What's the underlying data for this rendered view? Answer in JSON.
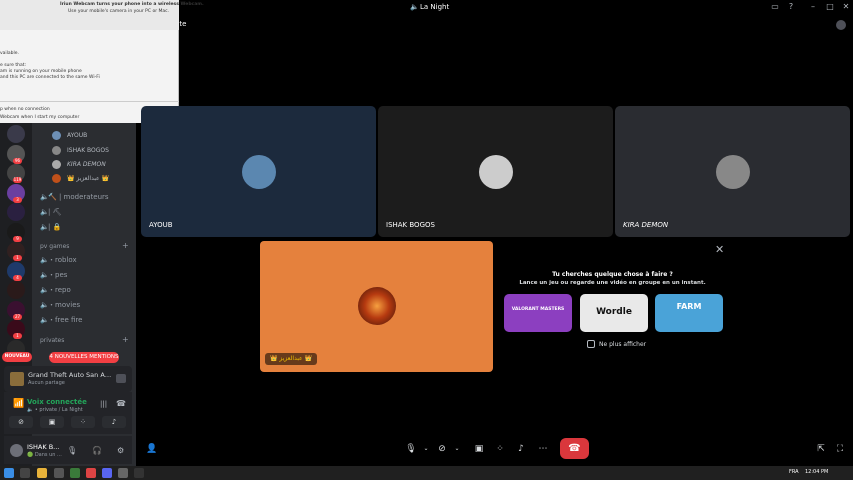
{
  "window": {
    "title": "La Night",
    "channel_header": "vate",
    "controls": {
      "minimize": "–",
      "maximize": "□",
      "close": "✕"
    }
  },
  "overlay": {
    "header_line1": "Iriun Webcam turns your phone into a wireless Webcam.",
    "header_line2": "Use your mobile's camera in your PC or Mac.",
    "line_available": "vailable.",
    "line_sure": "e sure that:",
    "line_running": "am is running on your mobile phone",
    "line_connected": "and this PC are connected to the same Wi-Fi",
    "line_noconn": "p when no connection",
    "line_start": "Webcam when I start my computer"
  },
  "servers": [
    {
      "color": "#3a3a4a",
      "badge": ""
    },
    {
      "color": "#555555",
      "badge": "96"
    },
    {
      "color": "#444444",
      "badge": "119"
    },
    {
      "color": "#6a3fa0",
      "badge": "3"
    },
    {
      "color": "#2a2040",
      "badge": ""
    },
    {
      "color": "#1a1a1a",
      "badge": "9"
    },
    {
      "color": "#302020",
      "badge": "1"
    },
    {
      "color": "#1e3a6a",
      "badge": "4"
    },
    {
      "color": "#2a1a1a",
      "badge": ""
    },
    {
      "color": "#3a1030",
      "badge": "27"
    },
    {
      "color": "#3a0a1a",
      "badge": "1"
    },
    {
      "color": "#2a2a2a",
      "badge": ""
    }
  ],
  "voice_users": [
    {
      "name": "AYOUB",
      "color": "#6d8fb5"
    },
    {
      "name": "ISHAK BOGOS",
      "color": "#888888"
    },
    {
      "name": "KIRA DEMON",
      "color": "#aaaaaa"
    },
    {
      "name": "👑 عبدالعزيز 👑",
      "color": "#c0501a"
    }
  ],
  "channels": {
    "moderateurs": "🔨 | moderateurs",
    "ch2": "| ⛏",
    "ch3": "| 🔒",
    "cat_pv": "pv games",
    "roblox": "・roblox",
    "pes": "・pes",
    "repo": "・repo",
    "movies": "・movies",
    "freefire": "・free fire",
    "cat_privates": "privates"
  },
  "badges": {
    "nouveau": "NOUVEAU",
    "mentions": "4 NOUVELLES MENTIONS"
  },
  "activity": {
    "game": "Grand Theft Auto San An...",
    "sub": "Aucun partage"
  },
  "voice": {
    "title": "Voix connectée",
    "sub": "🔈 • private / La Night"
  },
  "user": {
    "name": "ISHAK B...",
    "status": "🟢 Dans un ..."
  },
  "tiles": [
    {
      "name": "AYOUB",
      "bg": "#1c2a3d",
      "av": "#5b87b0"
    },
    {
      "name": "ISHAK BOGOS",
      "bg": "#1c1c1c",
      "av": "#cccccc"
    },
    {
      "name": "KIRA DEMON",
      "bg": "#2a2c31",
      "av": "#888888"
    }
  ],
  "focus": {
    "name": "👑 عبدالعزيز 👑"
  },
  "suggestion": {
    "title": "Tu cherches quelque chose à faire ?",
    "subtitle": "Lance un jeu ou regarde une vidéo en groupe en un instant.",
    "cards": [
      {
        "label": "VALORANT MASTERS",
        "bg": "#8c3fc0"
      },
      {
        "label": "Wordle",
        "bg": "#e9e9e9"
      },
      {
        "label": "FARM",
        "bg": "#4aa3d8"
      }
    ],
    "hide_label": "Ne plus afficher"
  },
  "taskbar": {
    "lang": "FRA",
    "time": "12:04 PM"
  }
}
